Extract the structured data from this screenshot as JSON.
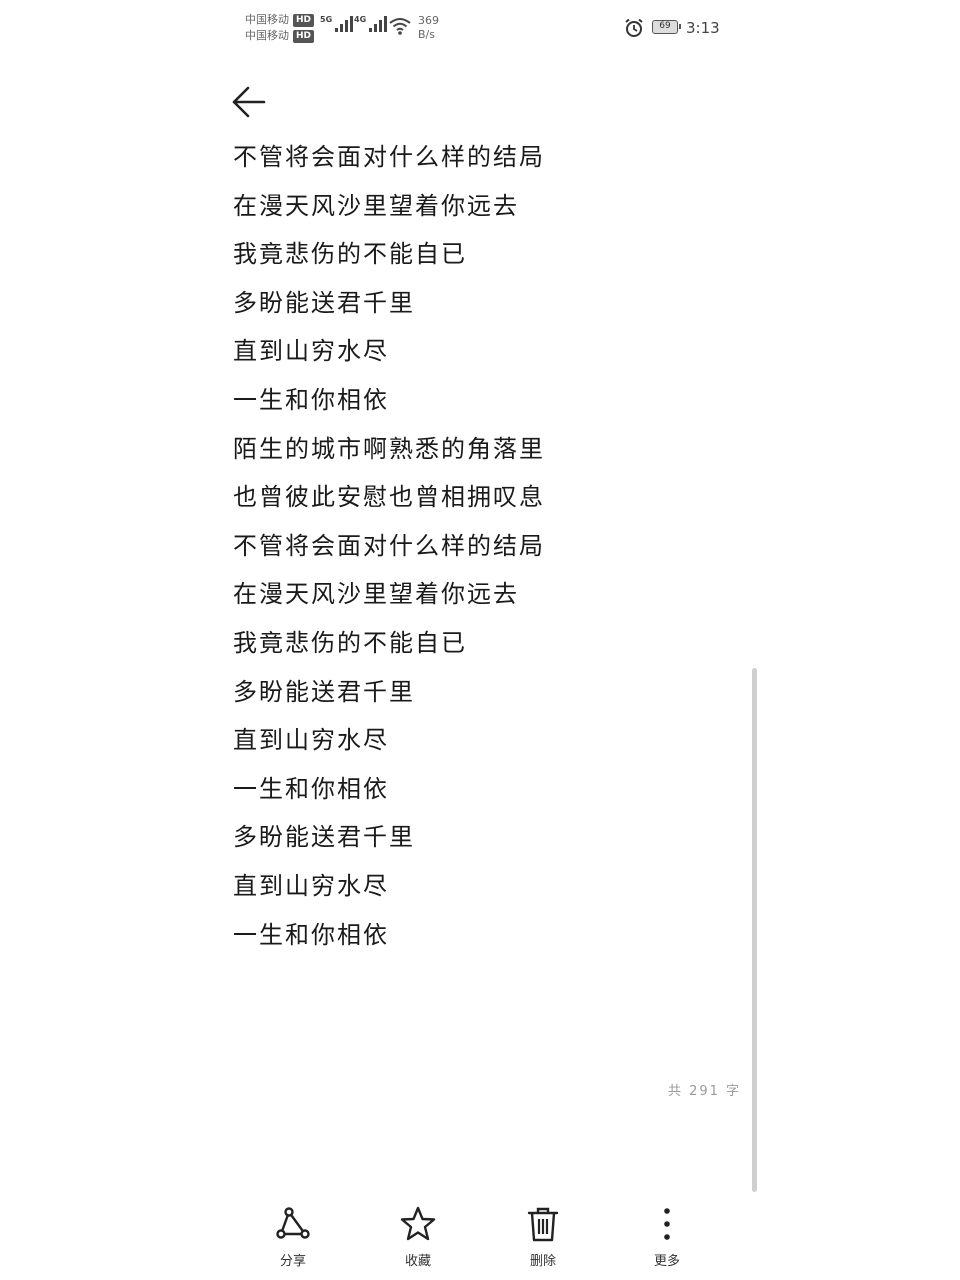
{
  "status_bar": {
    "carrier_1": "中国移动",
    "carrier_2": "中国移动",
    "hd_badge": "HD",
    "network_1": "5G",
    "network_2": "4G",
    "speed_value": "369",
    "speed_unit": "B/s",
    "battery": "69",
    "time": "3:13"
  },
  "note": {
    "lines": [
      "不管将会面对什么样的结局",
      "在漫天风沙里望着你远去",
      "我竟悲伤的不能自已",
      "多盼能送君千里",
      "直到山穷水尽",
      "一生和你相依",
      "陌生的城市啊熟悉的角落里",
      "也曾彼此安慰也曾相拥叹息",
      "不管将会面对什么样的结局",
      "在漫天风沙里望着你远去",
      "我竟悲伤的不能自已",
      "多盼能送君千里",
      "直到山穷水尽",
      "一生和你相依",
      "多盼能送君千里",
      "直到山穷水尽",
      "一生和你相依"
    ],
    "word_count": "共 291 字"
  },
  "toolbar": {
    "share_label": "分享",
    "favorite_label": "收藏",
    "delete_label": "删除",
    "more_label": "更多"
  }
}
